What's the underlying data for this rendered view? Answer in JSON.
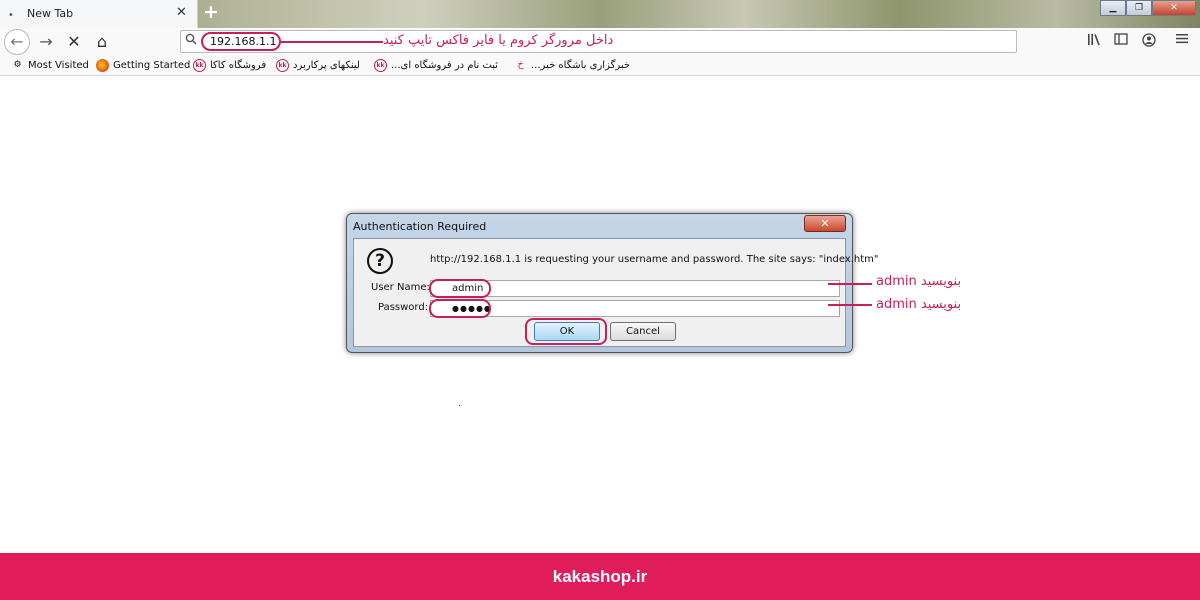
{
  "tab": {
    "title": "New Tab",
    "close_glyph": "✕",
    "new_tab_glyph": "+"
  },
  "window_controls": {
    "minimize": "▁",
    "restore": "❐",
    "close": "✕"
  },
  "nav": {
    "back_glyph": "←",
    "forward_glyph": "→",
    "stop_glyph": "✕",
    "home_glyph": "⌂",
    "url": "192.168.1.1",
    "url_annotation": "داخل مرورگر کروم یا فایر فاکس تایپ کنید"
  },
  "toolbar_icons": [
    "library-icon",
    "sidebar-icon",
    "account-icon",
    "menu-icon"
  ],
  "bookmarks": [
    {
      "label": "Most Visited",
      "icon": "gear-icon"
    },
    {
      "label": "Getting Started",
      "icon": "firefox-icon"
    },
    {
      "label": "فروشگاه کاکا",
      "icon": "kaka-icon"
    },
    {
      "label": "لینکهای پرکاربرد",
      "icon": "kaka-icon"
    },
    {
      "label": "ثبت نام در فروشگاه ای...",
      "icon": "kaka-icon"
    },
    {
      "label": "خبرگزاری باشگاه خبر...",
      "icon": "news-icon"
    }
  ],
  "dialog": {
    "title": "Authentication Required",
    "close_glyph": "✕",
    "message": "http://192.168.1.1 is requesting your username and password. The site says: \"index.htm\"",
    "username_label": "User Name:",
    "username_value": "admin",
    "password_label": "Password:",
    "password_value": "●●●●●",
    "ok_label": "OK",
    "cancel_label": "Cancel"
  },
  "annotations": {
    "username_note": "admin بنویسید",
    "password_note": "admin بنویسید"
  },
  "footer": {
    "brand": "kakashop.ir"
  },
  "colors": {
    "accent": "#e01c5b",
    "annotation": "#c81e5a"
  }
}
